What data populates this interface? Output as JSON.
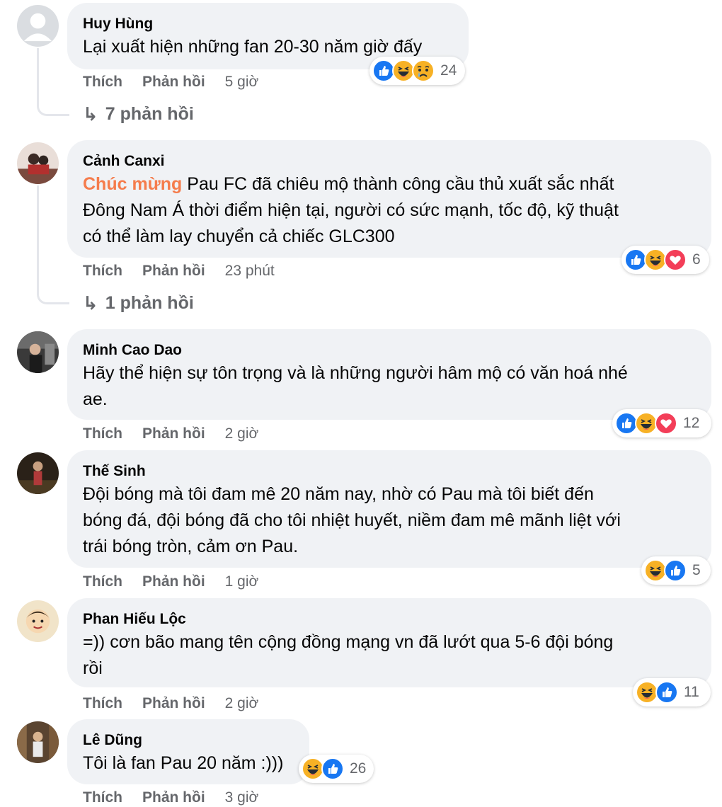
{
  "labels": {
    "like": "Thích",
    "reply": "Phản hồi"
  },
  "comments": [
    {
      "author": "Huy Hùng",
      "text": "Lại xuất hiện những fan 20-30 năm giờ đấy",
      "time": "5 giờ",
      "reactions": [
        "like-icon",
        "haha-icon",
        "sad-icon"
      ],
      "reaction_count": "24",
      "replies": "7 phản hồi"
    },
    {
      "author": "Cảnh Canxi",
      "mention": "Chúc mừng",
      "text_line1": " Pau FC đã chiêu mộ thành công cầu thủ xuất sắc nhất",
      "text_line2": "Đông Nam Á thời điểm hiện tại, người có sức mạnh, tốc độ, kỹ thuật",
      "text_line3": "có thể làm lay chuyển cả chiếc GLC300",
      "time": "23 phút",
      "reactions": [
        "like-icon",
        "haha-icon",
        "love-icon"
      ],
      "reaction_count": "6",
      "replies": "1 phản hồi"
    },
    {
      "author": "Minh Cao Dao",
      "text_line1": "Hãy thể hiện sự tôn trọng và là những người hâm mộ có văn hoá nhé",
      "text_line2": "ae.",
      "time": "2 giờ",
      "reactions": [
        "like-icon",
        "haha-icon",
        "love-icon"
      ],
      "reaction_count": "12"
    },
    {
      "author": "Thế Sinh",
      "text_line1": "Đội bóng mà tôi đam mê 20 năm nay, nhờ có Pau mà tôi biết đến",
      "text_line2": "bóng đá, đội bóng đã cho tôi nhiệt huyết, niềm đam mê mãnh liệt với",
      "text_line3": "trái bóng tròn, cảm ơn Pau.",
      "time": "1 giờ",
      "reactions": [
        "haha-icon",
        "like-icon"
      ],
      "reaction_count": "5"
    },
    {
      "author": "Phan Hiếu Lộc",
      "text_line1": "=)) cơn bão mang tên cộng đồng mạng vn đã lướt qua 5-6 đội bóng",
      "text_line2": "rồi",
      "time": "2 giờ",
      "reactions": [
        "haha-icon",
        "like-icon"
      ],
      "reaction_count": "11"
    },
    {
      "author": "Lê Dũng",
      "text": "Tôi là fan Pau 20 năm :)))",
      "time": "3 giờ",
      "reactions": [
        "haha-icon",
        "like-icon"
      ],
      "reaction_count": "26"
    }
  ],
  "colors": {
    "bubble": "#f0f2f5",
    "mention": "#f57c4c",
    "secondary_text": "#65676b",
    "like_blue": "#1877f2",
    "haha_yellow": "#f7b125",
    "love_red": "#f33e58"
  }
}
